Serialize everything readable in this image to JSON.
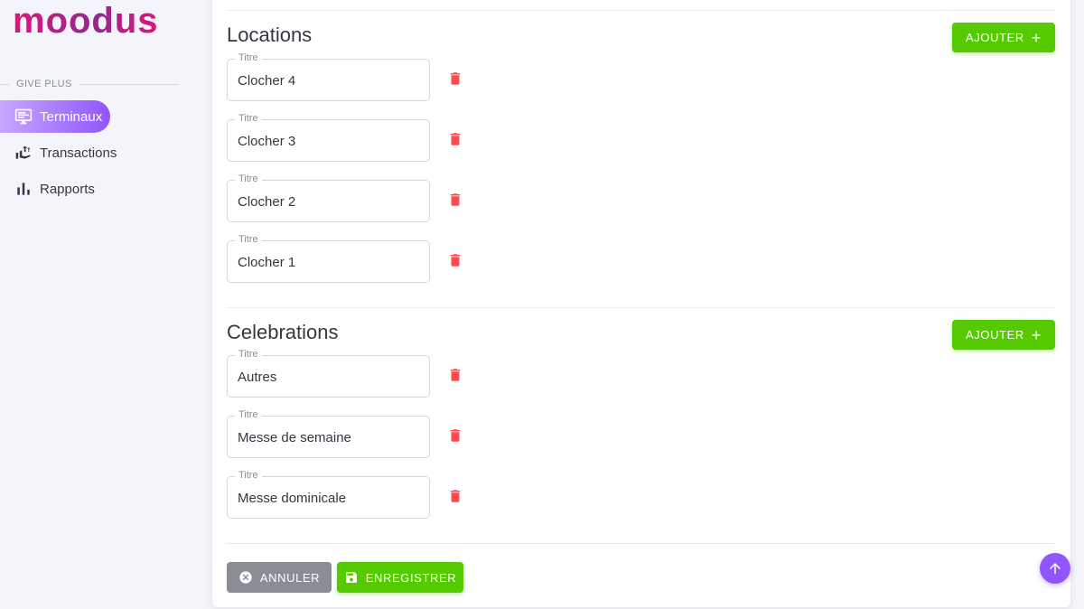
{
  "brand": {
    "logo_text": "moodus"
  },
  "sidebar": {
    "section_label": "GIVE PLUS",
    "items": [
      {
        "label": "Terminaux",
        "icon": "monitor-icon",
        "active": true
      },
      {
        "label": "Transactions",
        "icon": "hand-coin-icon",
        "active": false
      },
      {
        "label": "Rapports",
        "icon": "bar-chart-icon",
        "active": false
      }
    ]
  },
  "locations": {
    "title": "Locations",
    "add_label": "AJOUTER",
    "field_label": "Titre",
    "items": [
      {
        "value": "Clocher 4"
      },
      {
        "value": "Clocher 3"
      },
      {
        "value": "Clocher 2"
      },
      {
        "value": "Clocher 1"
      }
    ]
  },
  "celebrations": {
    "title": "Celebrations",
    "add_label": "AJOUTER",
    "field_label": "Titre",
    "items": [
      {
        "value": "Autres"
      },
      {
        "value": "Messe de semaine"
      },
      {
        "value": "Messe dominicale"
      }
    ]
  },
  "actions": {
    "cancel_label": "ANNULER",
    "save_label": "ENREGISTRER"
  },
  "colors": {
    "primary": "#9155fd",
    "success": "#56ca00",
    "danger": "#ff4c51",
    "secondary": "#8a8d93"
  }
}
